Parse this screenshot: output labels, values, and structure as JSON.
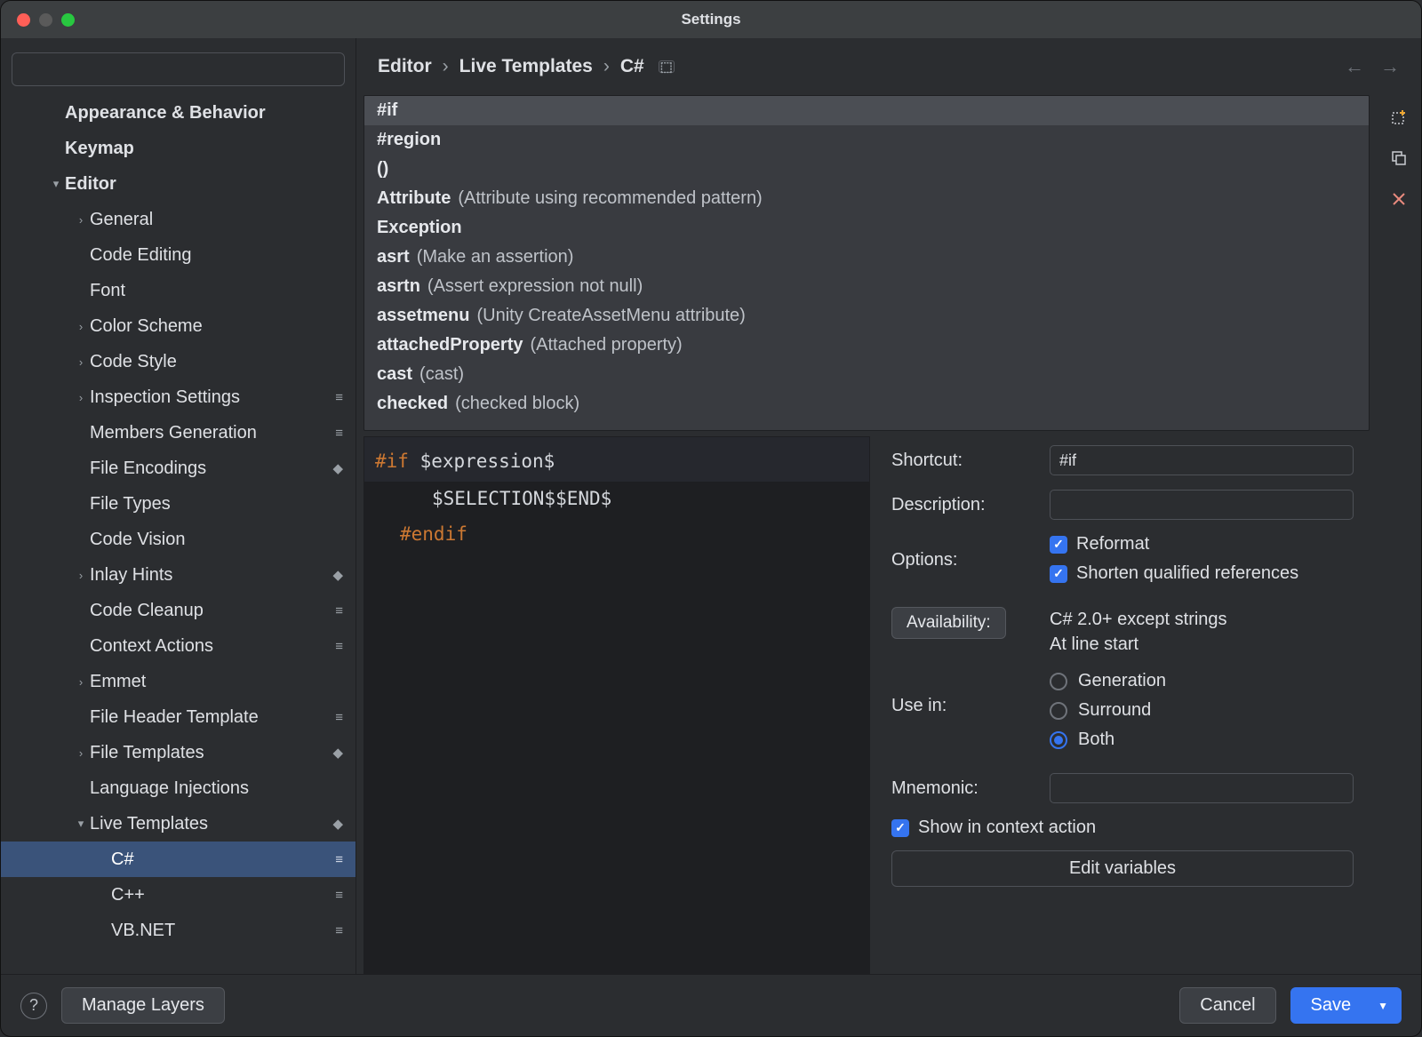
{
  "window": {
    "title": "Settings"
  },
  "sidebar": {
    "search_placeholder": "",
    "items": [
      {
        "label": "Appearance & Behavior",
        "indent": 1,
        "bold": true
      },
      {
        "label": "Keymap",
        "indent": 1,
        "bold": true
      },
      {
        "label": "Editor",
        "indent": 1,
        "bold": true,
        "chev": "▾"
      },
      {
        "label": "General",
        "indent": 2,
        "chev": "›"
      },
      {
        "label": "Code Editing",
        "indent": 2
      },
      {
        "label": "Font",
        "indent": 2
      },
      {
        "label": "Color Scheme",
        "indent": 2,
        "chev": "›"
      },
      {
        "label": "Code Style",
        "indent": 2,
        "chev": "›"
      },
      {
        "label": "Inspection Settings",
        "indent": 2,
        "chev": "›",
        "badge": "≡"
      },
      {
        "label": "Members Generation",
        "indent": 2,
        "badge": "≡"
      },
      {
        "label": "File Encodings",
        "indent": 2,
        "badge": "◆"
      },
      {
        "label": "File Types",
        "indent": 2
      },
      {
        "label": "Code Vision",
        "indent": 2
      },
      {
        "label": "Inlay Hints",
        "indent": 2,
        "chev": "›",
        "badge": "◆"
      },
      {
        "label": "Code Cleanup",
        "indent": 2,
        "badge": "≡"
      },
      {
        "label": "Context Actions",
        "indent": 2,
        "badge": "≡"
      },
      {
        "label": "Emmet",
        "indent": 2,
        "chev": "›"
      },
      {
        "label": "File Header Template",
        "indent": 2,
        "badge": "≡"
      },
      {
        "label": "File Templates",
        "indent": 2,
        "chev": "›",
        "badge": "◆"
      },
      {
        "label": "Language Injections",
        "indent": 2
      },
      {
        "label": "Live Templates",
        "indent": 2,
        "chev": "▾",
        "badge": "◆"
      },
      {
        "label": "C#",
        "indent": 3,
        "badge": "≡",
        "selected": true
      },
      {
        "label": "C++",
        "indent": 3,
        "badge": "≡"
      },
      {
        "label": "VB.NET",
        "indent": 3,
        "badge": "≡"
      }
    ]
  },
  "breadcrumb": {
    "parts": [
      "Editor",
      "Live Templates",
      "C#"
    ]
  },
  "templates": [
    {
      "abbr": "#if",
      "desc": "",
      "selected": true
    },
    {
      "abbr": "#region",
      "desc": ""
    },
    {
      "abbr": "()",
      "desc": ""
    },
    {
      "abbr": "Attribute",
      "desc": "(Attribute using recommended pattern)"
    },
    {
      "abbr": "Exception",
      "desc": ""
    },
    {
      "abbr": "asrt",
      "desc": "(Make an assertion)"
    },
    {
      "abbr": "asrtn",
      "desc": "(Assert expression not null)"
    },
    {
      "abbr": "assetmenu",
      "desc": "(Unity CreateAssetMenu attribute)"
    },
    {
      "abbr": "attachedProperty",
      "desc": "(Attached property)"
    },
    {
      "abbr": "cast",
      "desc": "(cast)"
    },
    {
      "abbr": "checked",
      "desc": "(checked block)"
    }
  ],
  "editor": {
    "line1_a": "#if",
    "line1_b": "$expression$",
    "line2": "$SELECTION$$END$",
    "line3": "#endif"
  },
  "form": {
    "shortcut_label": "Shortcut:",
    "shortcut_value": "#if",
    "description_label": "Description:",
    "description_value": "",
    "options_label": "Options:",
    "reformat_label": "Reformat",
    "shorten_label": "Shorten qualified references",
    "availability_btn": "Availability:",
    "availability_line1": "C# 2.0+ except strings",
    "availability_line2": "At line start",
    "usein_label": "Use in:",
    "radio_generation": "Generation",
    "radio_surround": "Surround",
    "radio_both": "Both",
    "mnemonic_label": "Mnemonic:",
    "mnemonic_value": "",
    "show_context_label": "Show in context action",
    "edit_vars_btn": "Edit variables"
  },
  "footer": {
    "manage_layers": "Manage Layers",
    "cancel": "Cancel",
    "save": "Save"
  }
}
